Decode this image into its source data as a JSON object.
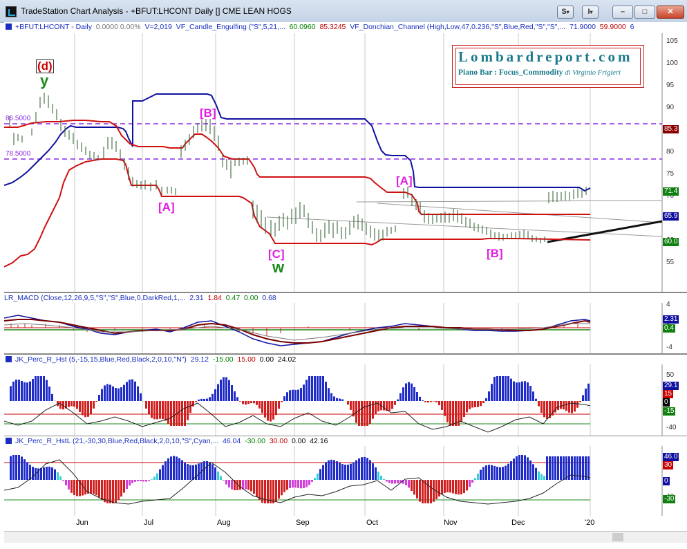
{
  "window": {
    "title": "TradeStation Chart Analysis - +BFUT:LHCONT Daily [] CME LEAN HOGS",
    "buttons": {
      "s": "S",
      "i": "I",
      "minimize": "–",
      "maximize": "□",
      "close": "✕"
    }
  },
  "price_pane": {
    "header": {
      "symbol": "+BFUT:LHCONT - Daily",
      "change": "0.0000  0.00%",
      "volume": "V=2,019",
      "indicator1": "VF_Candle_Engulfing (\"S\",5,21,...",
      "ind1_v1": "60.0960",
      "ind1_v2": "85.3245",
      "indicator2": "VF_Donchian_Channel (High,Low,47,0.236,\"S\",Blue,Red,\"S\",\"S\",...",
      "ind2_v1": "71.9000",
      "ind2_v2": "59.9000",
      "ind2_v3": "6"
    },
    "level_labels": [
      "86.5000",
      "78.5000"
    ],
    "axis_ticks": [
      "105",
      "100",
      "95",
      "90",
      "85",
      "80",
      "75",
      "70",
      "65",
      "60",
      "55"
    ],
    "price_tags": [
      "85.3",
      "71.4",
      "65.9",
      "60.0"
    ],
    "annotations": {
      "d": "(d)",
      "y": "y",
      "B1": "[B]",
      "A1": "[A]",
      "C": "[C]",
      "w": "w",
      "A2": "[A]",
      "B2": "[B]"
    }
  },
  "lombard": {
    "site": "Lombardreport.com",
    "subtitle": "Piano Bar : Focus_Commodity",
    "author": "di Virginio Frigieri"
  },
  "macd_pane": {
    "header": {
      "name": "LR_MACD (Close,12,26,9,5,\"S\",\"S\",Blue,0,DarkRed,1,...",
      "v1": "2.31",
      "v2": "1.84",
      "v3": "0.47",
      "v4": "0.00",
      "v5": "0.68"
    },
    "axis_ticks": [
      "4",
      "0",
      "-4"
    ],
    "tags": [
      "2.31",
      "0.4"
    ]
  },
  "perc_r1_pane": {
    "header": {
      "name": "JK_Perc_R_Hst (5,-15,15,Blue,Red,Black,2,0,10,\"N\")",
      "v1": "29.12",
      "v2": "-15.00",
      "v3": "15.00",
      "v4": "0.00",
      "v5": "24.02"
    },
    "axis_ticks": [
      "50",
      "-40"
    ],
    "tags": [
      "29.1",
      "15",
      "0",
      "-15"
    ]
  },
  "perc_r2_pane": {
    "header": {
      "name": "JK_Perc_R_HstL (21,-30,30,Blue,Red,Black,2,0,10,\"S\",Cyan,...",
      "v1": "46.04",
      "v2": "-30.00",
      "v3": "30.00",
      "v4": "0.00",
      "v5": "42.16"
    },
    "axis_ticks": [
      "40"
    ],
    "tags": [
      "46.0",
      "30",
      "0",
      "-30"
    ]
  },
  "xaxis": {
    "months": [
      "Jun",
      "Jul",
      "Aug",
      "Sep",
      "Oct",
      "Nov",
      "Dec",
      "'20"
    ]
  },
  "colors": {
    "donchian_upper": "#1010a0",
    "donchian_lower": "#d01010",
    "annot_magenta": "#e020e0",
    "annot_red": "#cc0000",
    "annot_green": "#1a8a1a"
  }
}
